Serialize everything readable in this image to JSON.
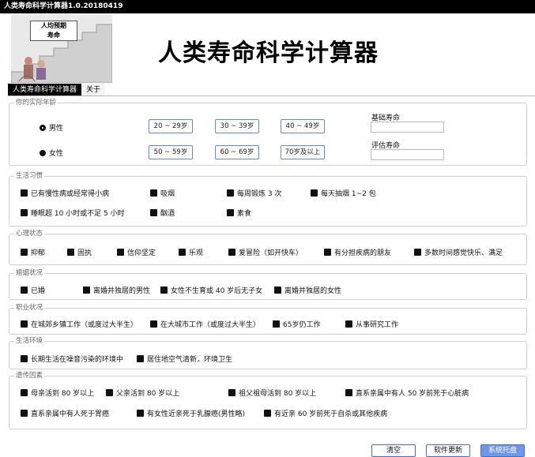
{
  "window": {
    "title": "人类寿命科学计算器1.0.20180419"
  },
  "logo": {
    "sign_line1": "人均预期",
    "sign_line2": "寿命"
  },
  "header": {
    "title": "人类寿命科学计算器"
  },
  "tabs": [
    {
      "label": "人类寿命科学计算器"
    },
    {
      "label": "关于"
    }
  ],
  "age": {
    "title": "你的实际年龄",
    "male": "男性",
    "female": "女性",
    "ranges_row1": [
      "20 ~ 29岁",
      "30 ~ 39岁",
      "40 ~ 49岁"
    ],
    "ranges_row2": [
      "50 ~ 59岁",
      "60 ~ 69岁",
      "70岁及以上"
    ],
    "base_label": "基础寿命",
    "base_value": "",
    "eval_label": "评估寿命",
    "eval_value": ""
  },
  "habits": {
    "title": "生活习惯",
    "items": [
      "已有慢性病或经常得小病",
      "吸烟",
      "每周锻炼 3 次",
      "每天抽烟 1~2 包",
      "睡眠超 10 小时或不足 5 小时",
      "酗酒",
      "素食"
    ]
  },
  "mental": {
    "title": "心理状态",
    "items": [
      "抑郁",
      "固执",
      "信仰坚定",
      "乐观",
      "爱冒险（如开快车）",
      "有分担疾病的朋友",
      "多数时间感觉快乐、满足"
    ]
  },
  "marriage": {
    "title": "婚姻状况",
    "items": [
      "已婚",
      "离婚并独居的男性",
      "女性不生育或 40 岁后无子女",
      "离婚并独居的女性"
    ]
  },
  "career": {
    "title": "职业状况",
    "items": [
      "在城郊乡镇工作（或度过大半生）",
      "在大城市工作（或度过大半生）",
      "65岁仍工作",
      "从事研究工作"
    ]
  },
  "environment": {
    "title": "生活环境",
    "items": [
      "长期生活在噪音污染的环境中",
      "居住地空气清新，环境卫生"
    ]
  },
  "genetics": {
    "title": "遗传因素",
    "items": [
      "母亲活到 80 岁以上",
      "父亲活到 80 岁以上",
      "祖父祖母活到 80 岁以上",
      "直系亲属中有人 50 岁前死于心脏病",
      "直系亲属中有人死于胃癌",
      "有女性近亲死于乳腺癌(男性略)",
      "有近亲 60 岁前死于自杀或其他疾病"
    ]
  },
  "footer": {
    "btn_clear": "清空",
    "btn_update": "软件更新",
    "btn_tray": "系统托盘"
  },
  "colors": {
    "btn_border": "#3b6fd1",
    "btn_primary": "#6f97e6",
    "age_border": "#5a8ad8"
  }
}
